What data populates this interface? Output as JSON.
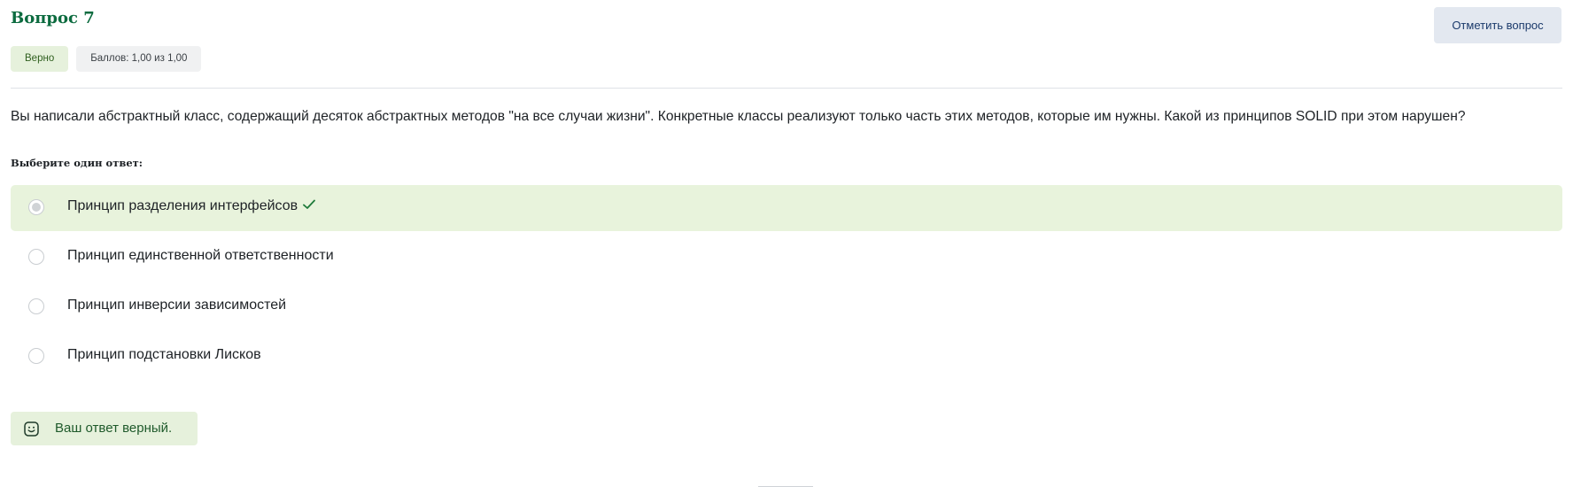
{
  "question": {
    "title": "Вопрос 7",
    "flag_label": "Отметить вопрос",
    "status_badge": "Верно",
    "score_badge": "Баллов: 1,00 из 1,00",
    "text": "Вы написали абстрактный класс, содержащий десяток абстрактных методов \"на все случаи жизни\". Конкретные классы реализуют только часть этих методов, которые им нужны. Какой из принципов SOLID при этом нарушен?",
    "prompt": "Выберите один ответ:"
  },
  "answers": [
    {
      "label": "Принцип разделения интерфейсов",
      "selected": true,
      "correct": true
    },
    {
      "label": "Принцип единственной ответственности",
      "selected": false,
      "correct": false
    },
    {
      "label": "Принцип инверсии зависимостей",
      "selected": false,
      "correct": false
    },
    {
      "label": "Принцип подстановки Лисков",
      "selected": false,
      "correct": false
    }
  ],
  "feedback": {
    "text": "Ваш ответ верный."
  },
  "icons": {
    "correct_mark": "check-icon",
    "feedback_icon": "smile-icon"
  },
  "colors": {
    "title": "#0c6b3f",
    "correct_bg": "#e8f3dc",
    "check": "#1e7a3a",
    "flag_bg": "#e3e8f0"
  }
}
